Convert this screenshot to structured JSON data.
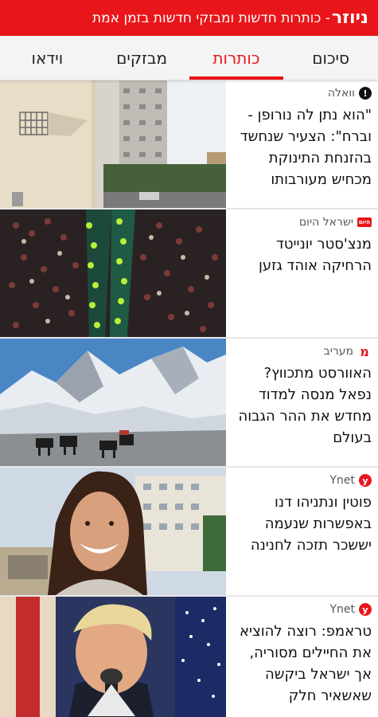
{
  "header": {
    "brand": "ניוזר",
    "tagline": "- כותרות חדשות ומבזקי חדשות בזמן אמת",
    "bg_color": "#e8161b"
  },
  "tabs": [
    {
      "label": "סיכום",
      "active": false
    },
    {
      "label": "כותרות",
      "active": true
    },
    {
      "label": "מבזקים",
      "active": false
    },
    {
      "label": "וידאו",
      "active": false
    }
  ],
  "articles": [
    {
      "source": "וואלה",
      "source_icon": "walla-logo-icon",
      "headline": "\"הוא נתן לה נורופן - וברח\": הצעיר שנחשד בהזנחת התינוקת מכחיש מעורבותו",
      "image": "building-window-photo"
    },
    {
      "source": "ישראל היום",
      "source_icon": "israel-hayom-logo-icon",
      "headline": "מנצ'סטר יונייטד הרחיקה אוהד גזען",
      "image": "stadium-crowd-photo"
    },
    {
      "source": "מעריב",
      "source_icon": "maariv-logo-icon",
      "headline": "האוורסט מתכווץ? נפאל מנסה למדוד מחדש את ההר הגבוה בעולם",
      "image": "everest-mountain-photo"
    },
    {
      "source": "Ynet",
      "source_icon": "ynet-logo-icon",
      "headline": "פוטין ונתניהו דנו באפשרות שנעמה יששכר תזכה לחנינה",
      "image": "woman-portrait-photo"
    },
    {
      "source": "Ynet",
      "source_icon": "ynet-logo-icon",
      "headline": "טראמפ: רוצה להוציא את החיילים מסוריה, אך ישראל ביקשה שאשאיר חלק",
      "image": "trump-podium-photo"
    }
  ]
}
